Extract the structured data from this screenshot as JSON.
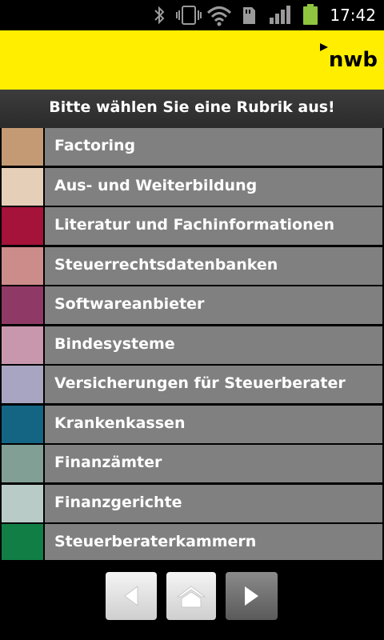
{
  "status_bar": {
    "time": "17:42",
    "icons": [
      "bluetooth-icon",
      "vibrate-icon",
      "wifi-icon",
      "sd-card-icon",
      "signal-icon",
      "battery-icon"
    ]
  },
  "header": {
    "logo_text": "nwb",
    "background": "#ffee00"
  },
  "title": "Bitte wählen Sie eine Rubrik aus!",
  "categories": [
    {
      "label": "Factoring",
      "color": "#c49a74"
    },
    {
      "label": "Aus- und Weiterbildung",
      "color": "#e6cfb8"
    },
    {
      "label": "Literatur und Fachinformationen",
      "color": "#a5123a"
    },
    {
      "label": "Steuerrechtsdatenbanken",
      "color": "#cc8c8a"
    },
    {
      "label": "Softwareanbieter",
      "color": "#8f3a66"
    },
    {
      "label": "Bindesysteme",
      "color": "#c896ad"
    },
    {
      "label": "Versicherungen für Steuerberater",
      "color": "#a8a5c2"
    },
    {
      "label": "Krankenkassen",
      "color": "#136583"
    },
    {
      "label": "Finanzämter",
      "color": "#819f95"
    },
    {
      "label": "Finanzgerichte",
      "color": "#b9cbc6"
    },
    {
      "label": "Steuerberaterkammern",
      "color": "#117f45"
    }
  ],
  "nav": {
    "buttons": [
      "back-icon",
      "home-icon",
      "forward-icon"
    ]
  }
}
